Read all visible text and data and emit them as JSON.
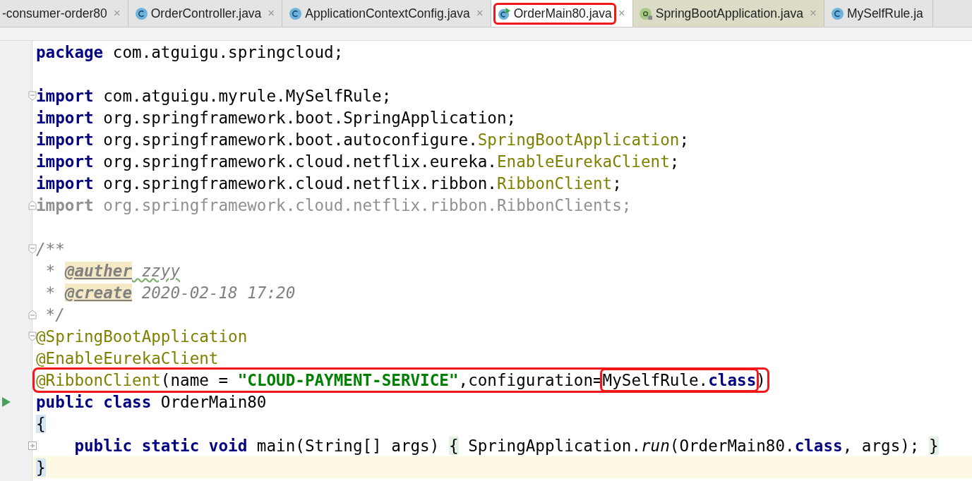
{
  "tabs": [
    {
      "label": "-consumer-order80",
      "close": "×",
      "kind": "plain",
      "selected": false,
      "marked": false
    },
    {
      "label": "OrderController.java",
      "close": "×",
      "kind": "class",
      "selected": false,
      "marked": false
    },
    {
      "label": "ApplicationContextConfig.java",
      "close": "×",
      "kind": "class",
      "selected": false,
      "marked": false
    },
    {
      "label": "OrderMain80.java",
      "close": "×",
      "kind": "main",
      "selected": true,
      "marked": true
    },
    {
      "label": "SpringBootApplication.java",
      "close": "×",
      "kind": "library",
      "selected": false,
      "marked": false
    },
    {
      "label": "MySelfRule.ja",
      "kind": "class",
      "selected": false,
      "marked": false
    }
  ],
  "code_lines": [
    {
      "marked": false,
      "current": false,
      "tokens": [
        {
          "kind": "kw",
          "text": "package"
        },
        {
          "kind": "plain",
          "text": " com.atguigu.springcloud;"
        }
      ]
    },
    {
      "marked": false,
      "current": false
    },
    {
      "gutter": {
        "kind": "fold"
      },
      "marked": false,
      "current": false,
      "tokens": [
        {
          "kind": "kw",
          "text": "import"
        },
        {
          "kind": "plain",
          "text": " com.atguigu.myrule.MySelfRule;"
        }
      ]
    },
    {
      "marked": false,
      "current": false,
      "tokens": [
        {
          "kind": "kw",
          "text": "import"
        },
        {
          "kind": "plain",
          "text": " org.springframework.boot.SpringApplication;"
        }
      ]
    },
    {
      "marked": false,
      "current": false,
      "tokens": [
        {
          "kind": "kw",
          "text": "import"
        },
        {
          "kind": "plain",
          "text": " org.springframework.boot.autoconfigure."
        },
        {
          "kind": "ann",
          "text": "SpringBootApplication"
        },
        {
          "kind": "plain",
          "text": ";"
        }
      ]
    },
    {
      "marked": false,
      "current": false,
      "tokens": [
        {
          "kind": "kw",
          "text": "import"
        },
        {
          "kind": "plain",
          "text": " org.springframework.cloud.netflix.eureka."
        },
        {
          "kind": "ann",
          "text": "EnableEurekaClient"
        },
        {
          "kind": "plain",
          "text": ";"
        }
      ]
    },
    {
      "marked": false,
      "current": false,
      "tokens": [
        {
          "kind": "kw",
          "text": "import"
        },
        {
          "kind": "plain",
          "text": " org.springframework.cloud.netflix.ribbon."
        },
        {
          "kind": "ann",
          "text": "RibbonClient"
        },
        {
          "kind": "plain",
          "text": ";"
        }
      ]
    },
    {
      "gutter": {
        "kind": "fold-end"
      },
      "marked": false,
      "current": false,
      "tokens": [
        {
          "kind": "unused-kw",
          "text": "import"
        },
        {
          "kind": "unused",
          "text": " org.springframework.cloud.netflix.ribbon.RibbonClients;"
        }
      ]
    },
    {
      "marked": false,
      "current": false
    },
    {
      "gutter": {
        "kind": "fold"
      },
      "marked": false,
      "current": false,
      "tokens": [
        {
          "kind": "doc",
          "text": "/**"
        }
      ]
    },
    {
      "marked": false,
      "current": false,
      "tokens": [
        {
          "kind": "doc",
          "text": " * "
        },
        {
          "kind": "doctag",
          "text": "@auther"
        },
        {
          "kind": "doc-typo",
          "text": " zzyy"
        }
      ]
    },
    {
      "marked": false,
      "current": false,
      "tokens": [
        {
          "kind": "doc",
          "text": " * "
        },
        {
          "kind": "doctag",
          "text": "@create"
        },
        {
          "kind": "doc",
          "text": " 2020-02-18 17:20"
        }
      ]
    },
    {
      "gutter": {
        "kind": "fold-end"
      },
      "marked": false,
      "current": false,
      "tokens": [
        {
          "kind": "doc",
          "text": " */"
        }
      ]
    },
    {
      "gutter": {
        "kind": "fold"
      },
      "marked": false,
      "current": false,
      "tokens": [
        {
          "kind": "ann",
          "text": "@SpringBootApplication"
        }
      ]
    },
    {
      "marked": false,
      "current": false,
      "tokens": [
        {
          "kind": "ann",
          "text": "@EnableEurekaClient"
        }
      ]
    },
    {
      "marked": true,
      "current": false,
      "tokens": [
        {
          "kind": "ann",
          "text": "@RibbonClient"
        },
        {
          "kind": "plain",
          "text": "(name = "
        },
        {
          "kind": "str",
          "text": "\"CLOUD-PAYMENT-SERVICE\""
        },
        {
          "kind": "plain",
          "text": ",configuration="
        },
        {
          "kind": "boxed",
          "tokens": [
            {
              "kind": "plain",
              "text": "MySelfRule."
            },
            {
              "kind": "kw",
              "text": "class"
            }
          ]
        },
        {
          "kind": "plain",
          "text": ")"
        }
      ]
    },
    {
      "gutter": {
        "kind": "run"
      },
      "marked": false,
      "current": false,
      "tokens": [
        {
          "kind": "kw",
          "text": "public class"
        },
        {
          "kind": "plain",
          "text": " OrderMain80"
        }
      ]
    },
    {
      "marked": false,
      "current": false,
      "tokens": [
        {
          "kind": "brace",
          "text": "{"
        }
      ]
    },
    {
      "gutter": {
        "kind": "expand"
      },
      "marked": false,
      "current": false,
      "tokens": [
        {
          "kind": "kw",
          "text": "    public static void"
        },
        {
          "kind": "plain",
          "text": " main(String[] args) "
        },
        {
          "kind": "folded",
          "text": "{"
        },
        {
          "kind": "plain",
          "text": " SpringApplication."
        },
        {
          "kind": "italic",
          "text": "run"
        },
        {
          "kind": "plain",
          "text": "(OrderMain80."
        },
        {
          "kind": "kw",
          "text": "class"
        },
        {
          "kind": "plain",
          "text": ", args); "
        },
        {
          "kind": "folded",
          "text": "}"
        }
      ]
    },
    {
      "marked": false,
      "current": true,
      "tokens": [
        {
          "kind": "brace",
          "text": "}"
        }
      ]
    }
  ]
}
